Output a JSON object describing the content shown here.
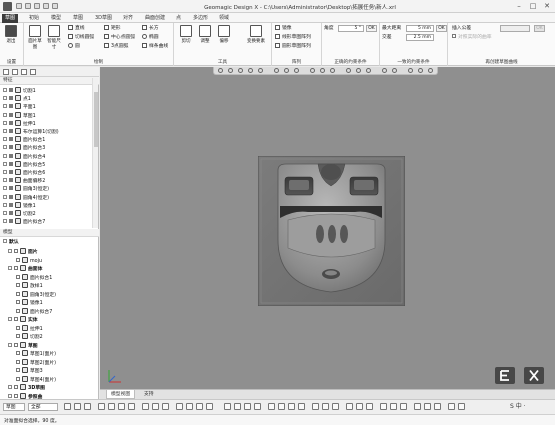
{
  "window": {
    "title": "Geomagic Design X - C:\\Users\\Administrator\\Desktop\\拓展任务\\新人.xrl",
    "minimize": "–",
    "maximize": "□",
    "close": "✕"
  },
  "menu_tabs": [
    {
      "label": "草图",
      "active": true
    },
    {
      "label": "初始"
    },
    {
      "label": "模型"
    },
    {
      "label": "草图"
    },
    {
      "label": "3D草图"
    },
    {
      "label": "对齐"
    },
    {
      "label": "曲面创建"
    },
    {
      "label": "点"
    },
    {
      "label": "多边形"
    },
    {
      "label": "领域"
    }
  ],
  "ribbon": {
    "groups": {
      "settings": "设置",
      "draw": "绘制",
      "tools": "工具",
      "array": "阵列",
      "dim_condition": "正确的约束条件",
      "fix_condition": "一致的约束条件",
      "extra": "再创建草图曲线"
    },
    "settings": {
      "exit": "退出"
    },
    "draw": {
      "line_btn": "直线",
      "tangent_arc": "切线圆弧",
      "rect": "矩形",
      "polygon": "多边形",
      "circle": "圆",
      "arc3": "3点圆弧",
      "ellipse": "椭圆",
      "slot": "长方",
      "arc_center": "中心点圆弧",
      "spline": "样条曲线",
      "big1": "面片草图",
      "big2": "智能尺寸",
      "cir_main": "○圆 ·",
      "arc_main": "○圆弧 ·",
      "line_main": "○直线 ·"
    },
    "tools": {
      "trim": "剪切",
      "adjust": "调整",
      "offset": "偏移",
      "transform": "变换要素"
    },
    "array": {
      "mirror": "镜像",
      "linear": "线形草图阵列",
      "circular": "圆形草图阵列"
    },
    "dims": {
      "angle_label": "角度",
      "angle_value": "5 °",
      "ok": "OK",
      "max_dist_label": "最大距离",
      "max_dist_value": "5 mm",
      "min_label": "交差",
      "min_value": "2.5 mm",
      "ok2": "OK"
    },
    "extra": {
      "insert_label": "插入公差",
      "checkbox_label": "对照实际的曲率"
    }
  },
  "left_panel": {
    "feature_tree_title": "特征",
    "feature_items": [
      {
        "label": "切割1"
      },
      {
        "label": "点1"
      },
      {
        "label": "平面1"
      },
      {
        "label": "草图1"
      },
      {
        "label": "拉伸1"
      },
      {
        "label": "布尔运算1(切割)"
      },
      {
        "label": "面片拟合1"
      },
      {
        "label": "面片拟合3"
      },
      {
        "label": "面片拟合4"
      },
      {
        "label": "面片拟合5"
      },
      {
        "label": "面片拟合6"
      },
      {
        "label": "曲面偏移2"
      },
      {
        "label": "圆角3(恒定)"
      },
      {
        "label": "圆角4(恒定)"
      },
      {
        "label": "镜像1"
      },
      {
        "label": "切割2"
      },
      {
        "label": "面片拟合7"
      }
    ],
    "model_tree_title": "模型",
    "model_root": "默认",
    "model_items": [
      {
        "label": "面片",
        "level": 1,
        "bold": true
      },
      {
        "label": "moju",
        "level": 2
      },
      {
        "label": "曲面体",
        "level": 1,
        "bold": true
      },
      {
        "label": "面片拟合1",
        "level": 2
      },
      {
        "label": "放样1",
        "level": 2
      },
      {
        "label": "圆角3(恒定)",
        "level": 2
      },
      {
        "label": "镜像1",
        "level": 2
      },
      {
        "label": "面片拟合7",
        "level": 2
      },
      {
        "label": "实体",
        "level": 1,
        "bold": true
      },
      {
        "label": "拉伸1",
        "level": 2
      },
      {
        "label": "切割2",
        "level": 2
      },
      {
        "label": "草图",
        "level": 1,
        "bold": true
      },
      {
        "label": "草图1(面片)",
        "level": 2
      },
      {
        "label": "草图2(面片)",
        "level": 2
      },
      {
        "label": "草图3",
        "level": 2
      },
      {
        "label": "草图4(面片)",
        "level": 2
      },
      {
        "label": "3D草图",
        "level": 1,
        "bold": true
      },
      {
        "label": "参照曲",
        "level": 1,
        "bold": true
      }
    ]
  },
  "view_tabs": [
    {
      "label": "模型视图",
      "active": true
    },
    {
      "label": "支持"
    }
  ],
  "bottom_bar": {
    "mode_label": "草图",
    "mode_select": "全部"
  },
  "status": {
    "text": "对准面拟合选择，90 度。"
  },
  "overlay": {
    "exit_icon": "exit-sketch-icon",
    "close_icon": "close-icon"
  },
  "colors": {
    "accent": "#3c3c3c",
    "viewport_bg": "#8f8f8f",
    "overlay_btn": "#474747"
  }
}
